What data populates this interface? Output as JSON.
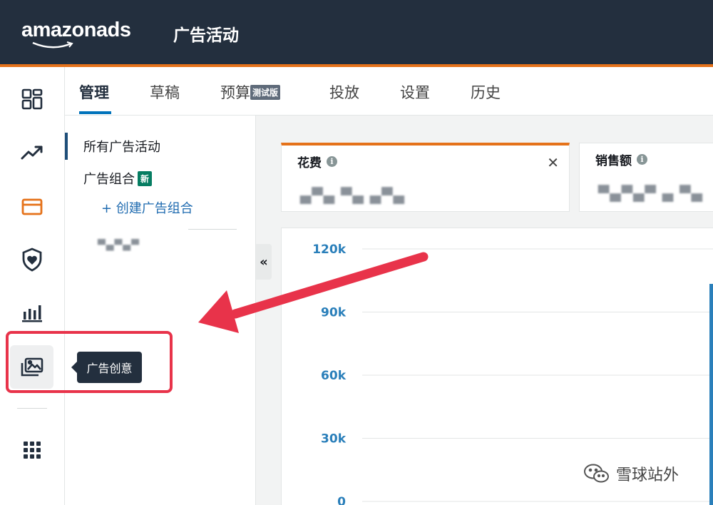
{
  "header": {
    "logo_text": "amazonads",
    "title": "广告活动",
    "brand_color": "#232f3e",
    "accent_color": "#e5721a"
  },
  "rail": {
    "items": [
      {
        "icon": "dashboard-icon"
      },
      {
        "icon": "trending-up-icon"
      },
      {
        "icon": "wallet-icon",
        "color": "#e5721a"
      },
      {
        "icon": "shield-heart-icon"
      },
      {
        "icon": "bar-chart-icon"
      },
      {
        "icon": "creative-gallery-icon",
        "active": true
      },
      {
        "icon": "apps-grid-icon"
      }
    ],
    "tooltip": "广告创意"
  },
  "tabs": {
    "items": [
      {
        "label": "管理",
        "active": true
      },
      {
        "label": "草稿"
      },
      {
        "label": "预算",
        "badge": "测试版"
      },
      {
        "label": "投放"
      },
      {
        "label": "设置"
      },
      {
        "label": "历史"
      }
    ]
  },
  "subnav": {
    "all_campaigns": "所有广告活动",
    "portfolios": "广告组合",
    "new_badge": "新",
    "create_portfolio": "+ 创建广告组合",
    "blurred_item": "▀▄▀▄▀"
  },
  "metrics": [
    {
      "label": "花费",
      "value": "▄▀▄ ▀▄ ▄▀▄",
      "selected": true,
      "selected_color": "#e5721a"
    },
    {
      "label": "销售额",
      "value": "▀▄▀▄▀ ▄ ▀▄"
    }
  ],
  "chart_data": {
    "type": "line",
    "y_ticks": [
      "120k",
      "90k",
      "60k",
      "30k",
      "0"
    ],
    "ylim": [
      0,
      120000
    ],
    "grid": true,
    "tick_color": "#2a7fba"
  },
  "watermark": {
    "text": "雪球站外"
  }
}
